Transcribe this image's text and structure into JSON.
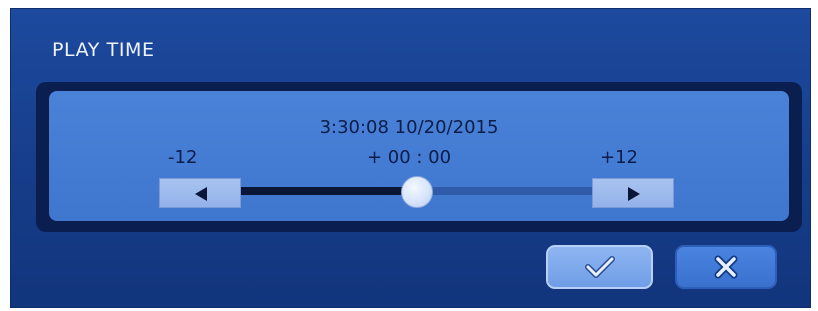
{
  "dialog": {
    "title": "PLAY TIME"
  },
  "playtime": {
    "datetime": "3:30:08 10/20/2015",
    "min_label": "-12",
    "offset_label": "+ 00 : 00",
    "max_label": "+12",
    "slider": {
      "min": -12,
      "max": 12,
      "value": 0
    }
  },
  "buttons": {
    "decrease_icon": "left-arrow-icon",
    "increase_icon": "right-arrow-icon",
    "confirm_icon": "checkmark-icon",
    "cancel_icon": "x-icon"
  },
  "colors": {
    "dialog_bg": "#1d4a9e",
    "panel_bg": "#4a82d8",
    "track_filled": "#0a1636",
    "track_empty": "#2f5ba8"
  }
}
